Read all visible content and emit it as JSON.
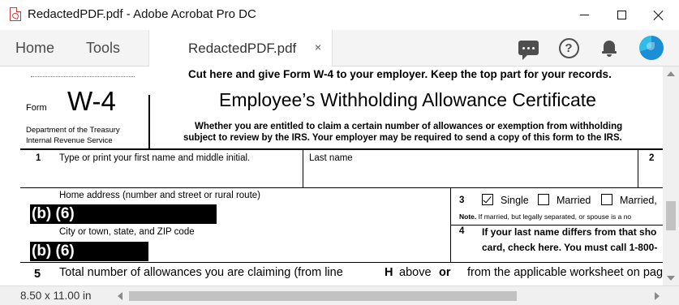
{
  "window": {
    "title": "RedactedPDF.pdf - Adobe Acrobat Pro DC"
  },
  "nav": {
    "home_label": "Home",
    "tools_label": "Tools",
    "doc_tab_label": "RedactedPDF.pdf",
    "doc_tab_close": "×"
  },
  "toolbar_icons": [
    "comment-icon",
    "help-icon",
    "bell-icon",
    "profile-icon"
  ],
  "document": {
    "cut_line": "Cut here and give Form W-4 to your employer. Keep the top part for your records.",
    "form_word": "Form",
    "form_number": "W-4",
    "dept_line1": "Department of the Treasury",
    "dept_line2": "Internal Revenue Service",
    "title": "Employee’s Withholding Allowance Certificate",
    "subtitle_line1": "Whether you are entitled to claim a certain number of allowances or exemption from withholding",
    "subtitle_line2": "subject to review by the IRS. Your employer may be required to send a copy of this form to the IRS.",
    "field1_num": "1",
    "field1_label": "Type or print your first name and middle initial.",
    "last_name_label": "Last name",
    "field2_num": "2",
    "home_address_label": "Home address (number and street or rural route)",
    "redaction_text": "(b) (6)",
    "city_label": "City or town, state, and ZIP code",
    "field3_num": "3",
    "filing_options": [
      {
        "label": "Single",
        "checked": true
      },
      {
        "label": "Married",
        "checked": false
      },
      {
        "label": "Married,",
        "checked": false
      }
    ],
    "note_bold": "Note.",
    "note_text": "If married, but legally separated, or spouse is a no",
    "field4_num": "4",
    "field4_line1": "If your last name differs from that sho",
    "field4_line2": "card, check here. You must call 1-800-",
    "field5_num": "5",
    "field5_text_a": "Total number of allowances you are claiming (from line",
    "field5_bold_h": "H",
    "field5_text_b": "above",
    "field5_bold_or": "or",
    "field5_text_c": "from the applicable worksheet on pag"
  },
  "status": {
    "page_size": "8.50 x 11.00 in"
  }
}
